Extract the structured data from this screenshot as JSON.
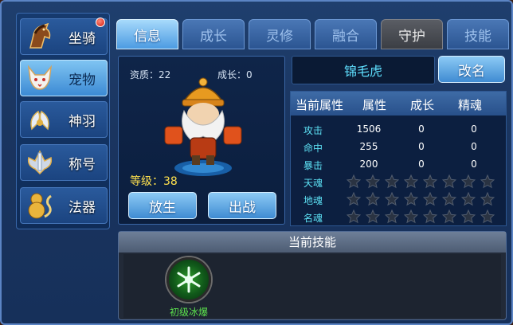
{
  "sidebar": {
    "items": [
      {
        "label": "坐骑",
        "icon": "horse-icon",
        "active": false,
        "badge": true
      },
      {
        "label": "宠物",
        "icon": "fox-icon",
        "active": true,
        "badge": false
      },
      {
        "label": "神羽",
        "icon": "feather-wing-icon",
        "active": false,
        "badge": false
      },
      {
        "label": "称号",
        "icon": "sword-emblem-icon",
        "active": false,
        "badge": false
      },
      {
        "label": "法器",
        "icon": "gourd-dragon-icon",
        "active": false,
        "badge": false
      }
    ]
  },
  "tabs": [
    {
      "label": "信息",
      "active": true
    },
    {
      "label": "成长",
      "active": false
    },
    {
      "label": "灵修",
      "active": false
    },
    {
      "label": "融合",
      "active": false
    },
    {
      "label": "守护",
      "active": false
    },
    {
      "label": "技能",
      "active": false
    }
  ],
  "pet": {
    "aptitude_label": "资质：22",
    "growth_label": "成长：0",
    "level_prefix": "等级：",
    "level_value": "38",
    "release_button": "放生",
    "battle_button": "出战",
    "name": "锦毛虎",
    "rename_button": "改名"
  },
  "attributes": {
    "headers": [
      "当前属性",
      "属性",
      "成长",
      "精魂"
    ],
    "rows": [
      {
        "label": "攻击",
        "value": "1506",
        "growth": "0",
        "soul": "0"
      },
      {
        "label": "命中",
        "value": "255",
        "growth": "0",
        "soul": "0"
      },
      {
        "label": "暴击",
        "value": "200",
        "growth": "0",
        "soul": "0"
      }
    ],
    "star_rows": [
      {
        "label": "天魂",
        "stars": 8
      },
      {
        "label": "地魂",
        "stars": 8
      },
      {
        "label": "名魂",
        "stars": 8
      }
    ]
  },
  "skills": {
    "title": "当前技能",
    "items": [
      {
        "name": "初级冰爆",
        "icon": "ice-burst-icon"
      }
    ]
  },
  "colors": {
    "accent": "#4c9be2",
    "cyan_text": "#5de2f5",
    "level_text": "#ffe14d",
    "skill_name": "#5ce24d"
  }
}
